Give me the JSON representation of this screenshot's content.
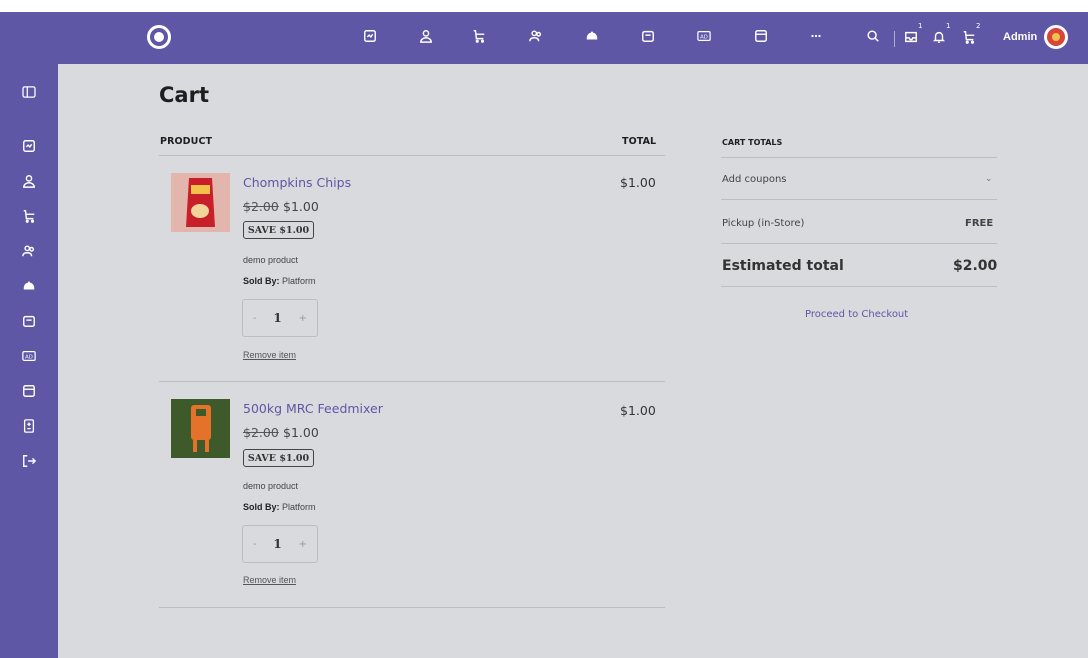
{
  "app": {
    "user_name": "Admin",
    "accent_color": "#5d57a5",
    "background_color": "#d8dade"
  },
  "topbar": {
    "logo_icon": "brand-logo",
    "icons": [
      "dashboard-icon",
      "user-icon",
      "cart-icon",
      "users-icon",
      "helmet-icon",
      "store-icon",
      "ad-icon",
      "window-icon",
      "more-icon",
      "search-icon"
    ],
    "notifications": {
      "inbox_count": "1",
      "bell_count": "1",
      "cart_count": "2"
    }
  },
  "sidebar": {
    "icons": [
      "panel-toggle-icon",
      "dashboard-icon",
      "user-icon",
      "cart-icon",
      "users-icon",
      "helmet-icon",
      "store-icon",
      "ad-icon",
      "window-icon",
      "calculator-icon",
      "logout-icon"
    ]
  },
  "page": {
    "title": "Cart",
    "product_header": "PRODUCT",
    "total_header": "TOTAL"
  },
  "cart": {
    "items": [
      {
        "name": "Chompkins Chips",
        "price_old": "$2.00",
        "price_new": "$1.00",
        "save": "SAVE $1.00",
        "description": "demo product",
        "sold_by_label": "Sold By:",
        "sold_by": "Platform",
        "quantity": "1",
        "remove": "Remove item",
        "total": "$1.00",
        "thumb_color": "#e2b6ad"
      },
      {
        "name": "500kg MRC Feedmixer",
        "price_old": "$2.00",
        "price_new": "$1.00",
        "save": "SAVE $1.00",
        "description": "demo product",
        "sold_by_label": "Sold By:",
        "sold_by": "Platform",
        "quantity": "1",
        "remove": "Remove item",
        "total": "$1.00",
        "thumb_color": "#3e5a2a"
      }
    ],
    "minus": "-",
    "plus": "+"
  },
  "totals": {
    "header": "CART TOTALS",
    "coupons": "Add coupons",
    "pickup_label": "Pickup (in-Store)",
    "pickup_value": "FREE",
    "estimated_label": "Estimated total",
    "estimated_value": "$2.00",
    "checkout": "Proceed to Checkout"
  }
}
